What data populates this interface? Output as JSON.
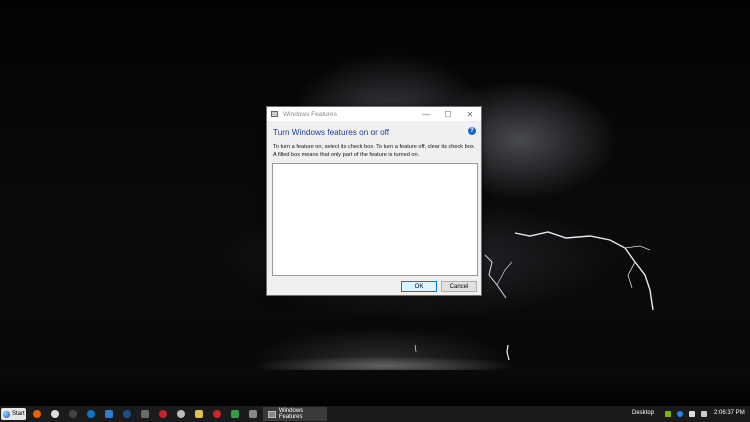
{
  "dialog": {
    "title": "Windows Features",
    "heading": "Turn Windows features on or off",
    "description": "To turn a feature on, select its check box. To turn a feature off, clear its check box. A filled box means that only part of the feature is turned on.",
    "ok_label": "OK",
    "cancel_label": "Cancel",
    "minimize_glyph": "—",
    "maximize_glyph": "☐",
    "close_glyph": "✕",
    "help_glyph": "?"
  },
  "taskbar": {
    "start_label": "Start",
    "active_task": "Windows Features",
    "desktop_label": "Desktop",
    "clock": "2:06:37 PM",
    "pinned_icons": [
      "firefox-icon",
      "chrome-icon",
      "steam-icon",
      "logitech-icon",
      "edge-icon",
      "steam-icon",
      "game-icon",
      "stop-icon",
      "folder-icon",
      "task-icon"
    ],
    "tray_icons": [
      "nvidia-icon",
      "bluetooth-icon",
      "network-icon",
      "volume-icon"
    ]
  },
  "colors": {
    "heading": "#1e3f9a",
    "accent": "#0078d7",
    "taskbar": "#1b1b1b"
  }
}
